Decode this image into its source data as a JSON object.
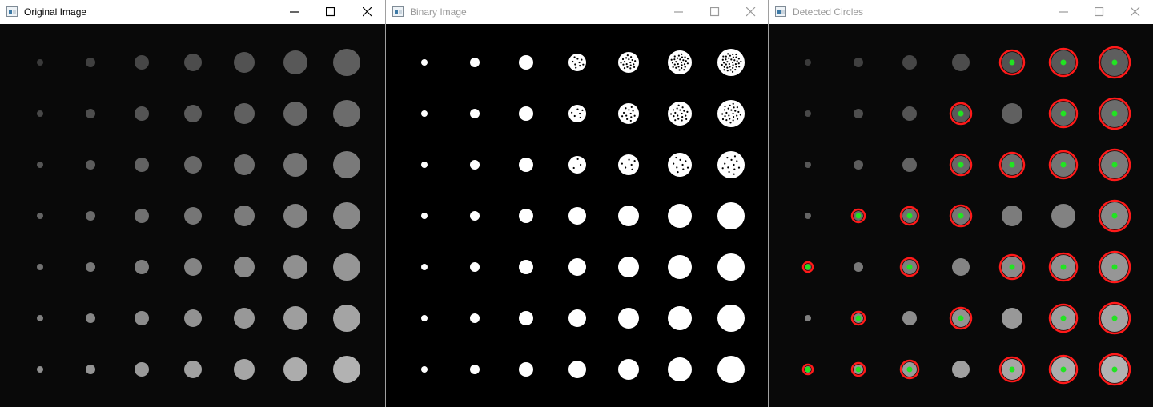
{
  "windows": [
    {
      "title": "Original Image",
      "active": true
    },
    {
      "title": "Binary Image",
      "active": false
    },
    {
      "title": "Detected Circles",
      "active": false
    }
  ],
  "icons": {
    "app": "opencv-window-icon",
    "minimize": "minimize-icon",
    "maximize": "maximize-icon",
    "close": "close-icon"
  },
  "colors": {
    "canvas_background": "#090909",
    "binary_background": "#000000",
    "binary_foreground": "#ffffff",
    "detection_circle": "#ff1a1a",
    "detection_center": "#22e322"
  },
  "dot_grid": {
    "rows": 7,
    "columns": 7,
    "detections": [
      [
        0,
        0,
        0,
        0,
        1,
        1,
        1
      ],
      [
        0,
        0,
        0,
        1,
        0,
        1,
        1
      ],
      [
        0,
        0,
        0,
        1,
        1,
        1,
        1
      ],
      [
        0,
        1,
        1,
        1,
        0,
        0,
        1
      ],
      [
        1,
        0,
        1,
        0,
        1,
        1,
        1
      ],
      [
        0,
        1,
        0,
        1,
        0,
        1,
        1
      ],
      [
        1,
        1,
        1,
        0,
        1,
        1,
        1
      ]
    ]
  }
}
